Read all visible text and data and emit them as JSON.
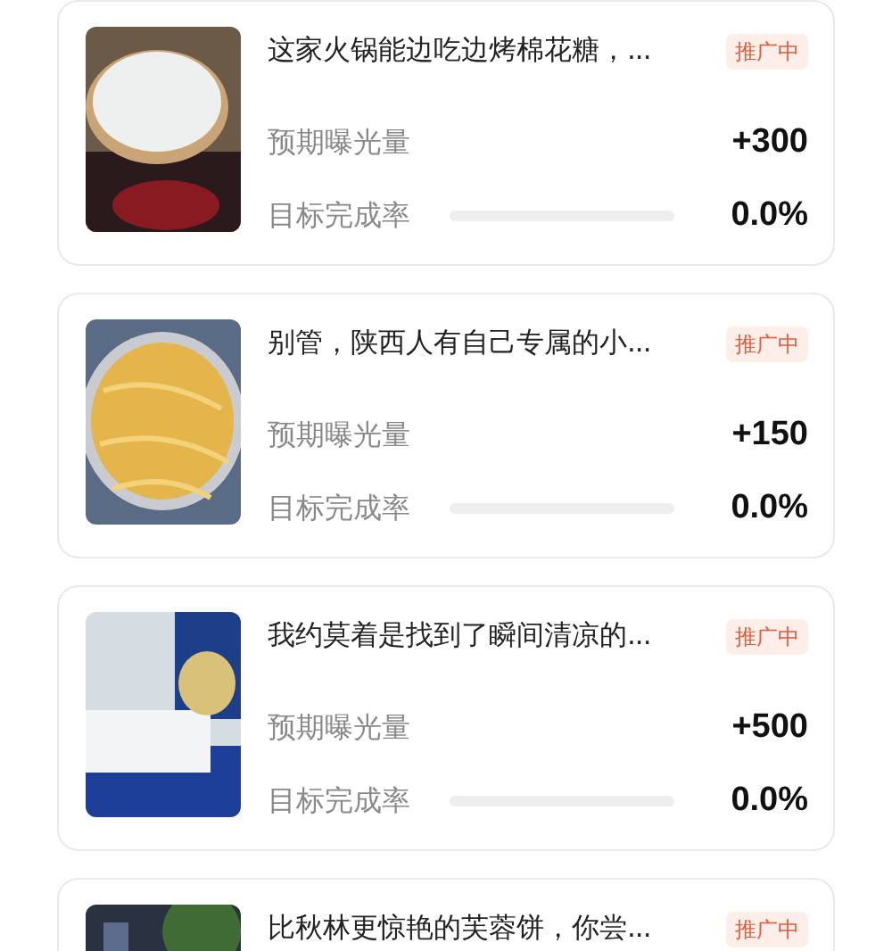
{
  "cards": [
    {
      "title": "这家火锅能边吃边烤棉花糖，...",
      "badge": "推广中",
      "kind": "picture",
      "exposure_label": "预期曝光量",
      "exposure_value": "+300",
      "completion_label": "目标完成率",
      "level": 0,
      "completion_value": "0.0%"
    },
    {
      "title": "别管，陕西人有自己专属的小...",
      "badge": "推广中",
      "kind": "picture",
      "exposure_label": "预期曝光量",
      "exposure_value": "+150",
      "completion_label": "目标完成率",
      "level": 0,
      "completion_value": "0.0%"
    },
    {
      "title": "我约莫着是找到了瞬间清凉的...",
      "badge": "推广中",
      "kind": "picture",
      "exposure_label": "预期曝光量",
      "exposure_value": "+500",
      "completion_label": "目标完成率",
      "level": 0,
      "completion_value": "0.0%"
    },
    {
      "title": "比秋林更惊艳的芙蓉饼，你尝...",
      "badge": "推广中",
      "kind": "picture"
    }
  ]
}
